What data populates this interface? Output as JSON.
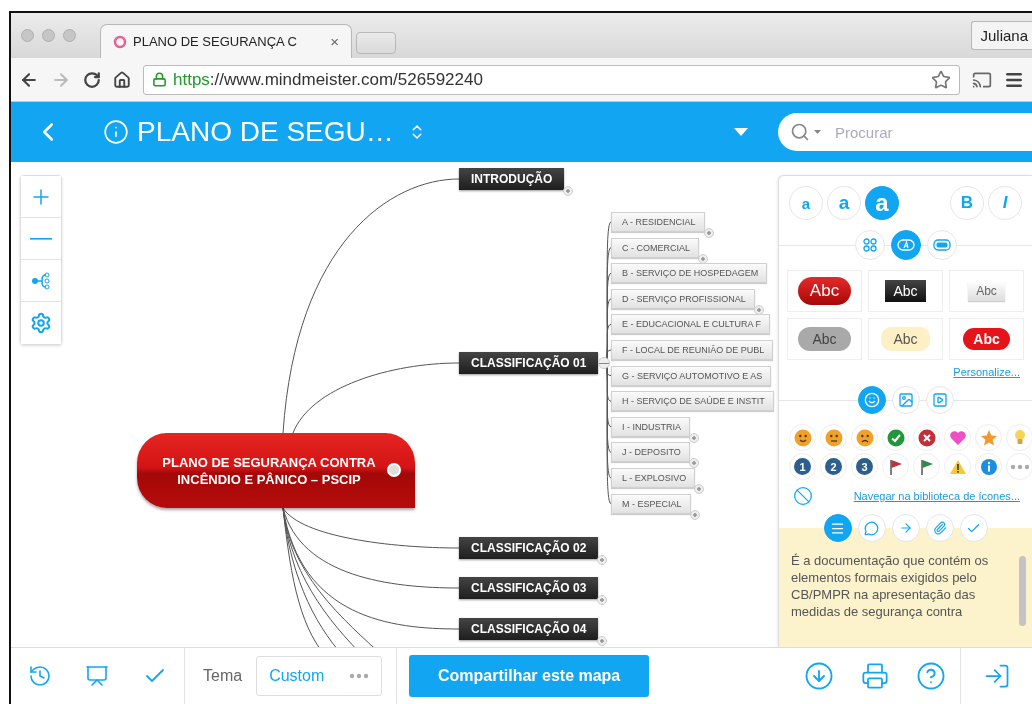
{
  "browser": {
    "tab": {
      "title": "PLANO DE SEGURANÇA C",
      "close": "×"
    },
    "profile": "Juliana",
    "url": {
      "scheme": "https",
      "rest": "://www.mindmeister.com/526592240"
    }
  },
  "header": {
    "title": "PLANO DE SEGU…",
    "search": {
      "placeholder": "Procurar"
    }
  },
  "mindmap": {
    "root": {
      "label": "PLANO DE SEGURANÇA CONTRA INCÊNDIO E PÂNICO – PSCIP"
    },
    "branches": [
      {
        "label": "INTRODUÇÃO",
        "collapsed": true
      },
      {
        "label": "CLASSIFICAÇÃO 01",
        "collapsed": false,
        "children": [
          {
            "label": "A - RESIDENCIAL",
            "collapsed": true
          },
          {
            "label": "C - COMERCIAL",
            "collapsed": true
          },
          {
            "label": "B - SERVIÇO DE HOSPEDAGEM"
          },
          {
            "label": "D - SERVIÇO PROFISSIONAL",
            "collapsed": true
          },
          {
            "label": "E - EDUCACIONAL E CULTURA F"
          },
          {
            "label": "F - LOCAL DE REUNIÃO DE PUBL"
          },
          {
            "label": "G - SERVIÇO AUTOMOTIVO E AS"
          },
          {
            "label": "H - SERVIÇO DE SAÚDE E INSTIT"
          },
          {
            "label": "I - INDUSTRIA",
            "collapsed": true
          },
          {
            "label": "J - DEPOSITO",
            "collapsed": true
          },
          {
            "label": "L - EXPLOSIVO",
            "collapsed": true
          },
          {
            "label": "M - ESPECIAL",
            "collapsed": true
          }
        ]
      },
      {
        "label": "CLASSIFICAÇÃO 02",
        "collapsed": true
      },
      {
        "label": "CLASSIFICAÇÃO 03",
        "collapsed": true
      },
      {
        "label": "CLASSIFICAÇÃO 04",
        "collapsed": true
      }
    ]
  },
  "format_panel": {
    "font_sizes": [
      {
        "label": "a",
        "selected": false
      },
      {
        "label": "a",
        "selected": false
      },
      {
        "label": "a",
        "selected": true
      }
    ],
    "font_styles": [
      {
        "label": "B",
        "selected": false
      },
      {
        "label": "I",
        "selected": false
      }
    ],
    "style_tabs": [
      {
        "kind": "layout",
        "selected": false
      },
      {
        "kind": "text",
        "selected": true
      },
      {
        "kind": "shape",
        "selected": false
      }
    ],
    "styles": [
      {
        "label": "Abc",
        "kind": "red-gloss"
      },
      {
        "label": "Abc",
        "kind": "dark"
      },
      {
        "label": "Abc",
        "kind": "light"
      },
      {
        "label": "Abc",
        "kind": "grey"
      },
      {
        "label": "Abc",
        "kind": "cream"
      },
      {
        "label": "Abc",
        "kind": "red"
      }
    ],
    "customize_link": "Personalize...",
    "media_tabs": [
      {
        "kind": "emoji",
        "selected": true
      },
      {
        "kind": "image",
        "selected": false
      },
      {
        "kind": "video",
        "selected": false
      }
    ],
    "icons": [
      {
        "kind": "smile"
      },
      {
        "kind": "neutral"
      },
      {
        "kind": "sad"
      },
      {
        "kind": "check"
      },
      {
        "kind": "cross"
      },
      {
        "kind": "heart"
      },
      {
        "kind": "star"
      },
      {
        "kind": "bulb"
      },
      {
        "kind": "number",
        "label": "1"
      },
      {
        "kind": "number",
        "label": "2"
      },
      {
        "kind": "number",
        "label": "3"
      },
      {
        "kind": "flag-red"
      },
      {
        "kind": "flag-green"
      },
      {
        "kind": "warning"
      },
      {
        "kind": "info"
      },
      {
        "kind": "more"
      }
    ],
    "browse_link": "Navegar na biblioteca de ícones...",
    "note_tabs": [
      {
        "kind": "note",
        "selected": true
      },
      {
        "kind": "comment",
        "selected": false
      },
      {
        "kind": "link",
        "selected": false
      },
      {
        "kind": "attachment",
        "selected": false
      },
      {
        "kind": "task",
        "selected": false
      }
    ],
    "note": "É a documentação que contém os elementos formais exigidos pelo CB/PMPR na apresentação das medidas de segurança contra"
  },
  "bottom_bar": {
    "theme": {
      "label": "Tema",
      "value": "Custom"
    },
    "share_button": "Compartilhar este mapa"
  }
}
